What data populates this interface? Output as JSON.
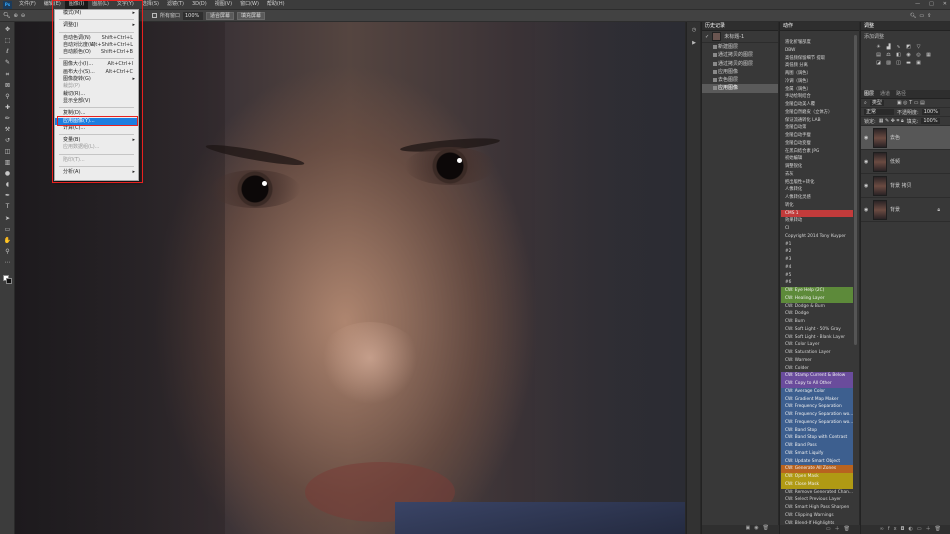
{
  "menubar": {
    "items": [
      "文件(F)",
      "编辑(E)",
      "图像(I)",
      "图层(L)",
      "文字(Y)",
      "选择(S)",
      "滤镜(T)",
      "3D(D)",
      "视图(V)",
      "窗口(W)",
      "帮助(H)"
    ],
    "active_index": 2,
    "window_controls": [
      "—",
      "□",
      "✕"
    ]
  },
  "optionsbar": {
    "scroll_all_windows_label": "所有窗口",
    "zoom_value": "100%",
    "fit_screen_label": "适合屏幕",
    "fill_screen_label": "填充屏幕"
  },
  "image_menu": {
    "items": [
      {
        "label": "模式(M)",
        "submenu": true
      },
      {
        "sep": true
      },
      {
        "label": "调整(J)",
        "submenu": true
      },
      {
        "sep": true
      },
      {
        "label": "自动色调(N)",
        "shortcut": "Shift+Ctrl+L"
      },
      {
        "label": "自动对比度(U)",
        "shortcut": "Alt+Shift+Ctrl+L"
      },
      {
        "label": "自动颜色(O)",
        "shortcut": "Shift+Ctrl+B"
      },
      {
        "sep": true
      },
      {
        "label": "图像大小(I)...",
        "shortcut": "Alt+Ctrl+I"
      },
      {
        "label": "画布大小(S)...",
        "shortcut": "Alt+Ctrl+C"
      },
      {
        "label": "图像旋转(G)",
        "submenu": true
      },
      {
        "label": "裁剪(P)",
        "disabled": true
      },
      {
        "label": "裁切(R)..."
      },
      {
        "label": "显示全部(V)"
      },
      {
        "sep": true
      },
      {
        "label": "复制(D)..."
      },
      {
        "label": "应用图像(Y)...",
        "highlighted": true
      },
      {
        "label": "计算(C)..."
      },
      {
        "sep": true
      },
      {
        "label": "变量(B)",
        "submenu": true
      },
      {
        "label": "应用数据组(L)...",
        "disabled": true
      },
      {
        "sep": true
      },
      {
        "label": "陷印(T)...",
        "disabled": true
      },
      {
        "sep": true
      },
      {
        "label": "分析(A)",
        "submenu": true
      }
    ]
  },
  "history": {
    "title": "历史记录",
    "snapshot_label": "未标题-1",
    "rows": [
      "新建图层",
      "通过拷贝的图层",
      "通过拷贝的图层",
      "应用图像",
      "去色图层",
      "应用图像"
    ],
    "current_index": 5
  },
  "actions": {
    "title": "动作",
    "rows": [
      {
        "label": "液化折皱部度",
        "color": ""
      },
      {
        "label": "DBW",
        "color": ""
      },
      {
        "label": "高低频保留细节 提取",
        "color": ""
      },
      {
        "label": "高低频 分离",
        "color": ""
      },
      {
        "label": "两图（调色）",
        "color": ""
      },
      {
        "label": "冷调（调色）",
        "color": ""
      },
      {
        "label": "金属（调色）",
        "color": ""
      },
      {
        "label": "手动绘制结合",
        "color": ""
      },
      {
        "label": "金陵自动美人覆",
        "color": ""
      },
      {
        "label": "金陵自然磨皮（立体方）",
        "color": ""
      },
      {
        "label": "保证流通转化 LAB",
        "color": ""
      },
      {
        "label": "金陵自动第",
        "color": ""
      },
      {
        "label": "金陵自动手瘦",
        "color": ""
      },
      {
        "label": "金陵自动变瘦",
        "color": ""
      },
      {
        "label": "在黑白结合素 JPG",
        "color": ""
      },
      {
        "label": "初始编辑",
        "color": ""
      },
      {
        "label": "调整锐化",
        "color": ""
      },
      {
        "label": "去灰",
        "color": ""
      },
      {
        "label": "把出版性+转化",
        "color": ""
      },
      {
        "label": "人像转化",
        "color": ""
      },
      {
        "label": "人像转化灵感",
        "color": ""
      },
      {
        "label": "转化",
        "color": ""
      },
      {
        "label": "CMS 1",
        "color": "#c23b3b"
      },
      {
        "label": "效果转动",
        "color": ""
      },
      {
        "label": "CI",
        "color": ""
      },
      {
        "label": "Copyright 2014 Tony Kuyper",
        "color": ""
      },
      {
        "label": "#1",
        "color": ""
      },
      {
        "label": "#2",
        "color": ""
      },
      {
        "label": "#3",
        "color": ""
      },
      {
        "label": "#4",
        "color": ""
      },
      {
        "label": "#5",
        "color": ""
      },
      {
        "label": "#6",
        "color": ""
      },
      {
        "label": "CW: Eye Help (2C)",
        "color": "#5d8a3a"
      },
      {
        "label": "CW: Healing Layer",
        "color": "#5d8a3a"
      },
      {
        "label": "CW: Dodge & Burn",
        "color": ""
      },
      {
        "label": "CW: Dodge",
        "color": ""
      },
      {
        "label": "CW: Burn",
        "color": ""
      },
      {
        "label": "CW: Soft Light - 50% Gray",
        "color": ""
      },
      {
        "label": "CW: Soft Light - Blank Layer",
        "color": ""
      },
      {
        "label": "CW: Color Layer",
        "color": ""
      },
      {
        "label": "CW: Saturation Layer",
        "color": ""
      },
      {
        "label": "CW: Warmer",
        "color": ""
      },
      {
        "label": "CW: Colder",
        "color": ""
      },
      {
        "label": "CW: Stamp Current & Below",
        "color": "#6a4c9c"
      },
      {
        "label": "CW: Copy to All Other",
        "color": "#6a4c9c"
      },
      {
        "label": "CW: Average Color",
        "color": "#3d5f8f"
      },
      {
        "label": "CW: Gradient Map Maker",
        "color": "#3d5f8f"
      },
      {
        "label": "CW: Frequency Separation",
        "color": "#3d5f8f"
      },
      {
        "label": "CW: Frequency Separation wo...",
        "color": "#3d5f8f"
      },
      {
        "label": "CW: Frequency Separation wo...",
        "color": "#3d5f8f"
      },
      {
        "label": "CW: Band Stop",
        "color": "#3d5f8f"
      },
      {
        "label": "CW: Band Stop with Contrast",
        "color": "#3d5f8f"
      },
      {
        "label": "CW: Band Pass",
        "color": "#3d5f8f"
      },
      {
        "label": "CW: Smart Liquify",
        "color": "#3d5f8f"
      },
      {
        "label": "CW: Update Smart Object",
        "color": "#3d5f8f"
      },
      {
        "label": "CW: Generate All Zones",
        "color": "#b8631f"
      },
      {
        "label": "CW: Open Mask",
        "color": "#b09a14"
      },
      {
        "label": "CW: Close Mask",
        "color": "#b09a14"
      },
      {
        "label": "CW: Remove Generated Chan...",
        "color": ""
      },
      {
        "label": "CW: Select Previous Layer",
        "color": ""
      },
      {
        "label": "CW: Smart High Pass Sharpen",
        "color": ""
      },
      {
        "label": "CW: Clipping Warnings",
        "color": ""
      },
      {
        "label": "CW: Blend-If Highlights",
        "color": ""
      }
    ]
  },
  "adjustments": {
    "title": "调整",
    "subtitle": "添加调整"
  },
  "layers": {
    "tabs": [
      "图层",
      "通道",
      "路径"
    ],
    "kind_label": "类型",
    "blend_mode": "正常",
    "opacity_label": "不透明度:",
    "opacity_value": "100%",
    "lock_label": "锁定:",
    "fill_label": "填充:",
    "fill_value": "100%",
    "items": [
      {
        "name": "去色",
        "selected": true,
        "locked": false
      },
      {
        "name": "低频",
        "selected": false,
        "locked": false
      },
      {
        "name": "背景 拷贝",
        "selected": false,
        "locked": false
      },
      {
        "name": "背景",
        "selected": false,
        "locked": true
      }
    ]
  }
}
